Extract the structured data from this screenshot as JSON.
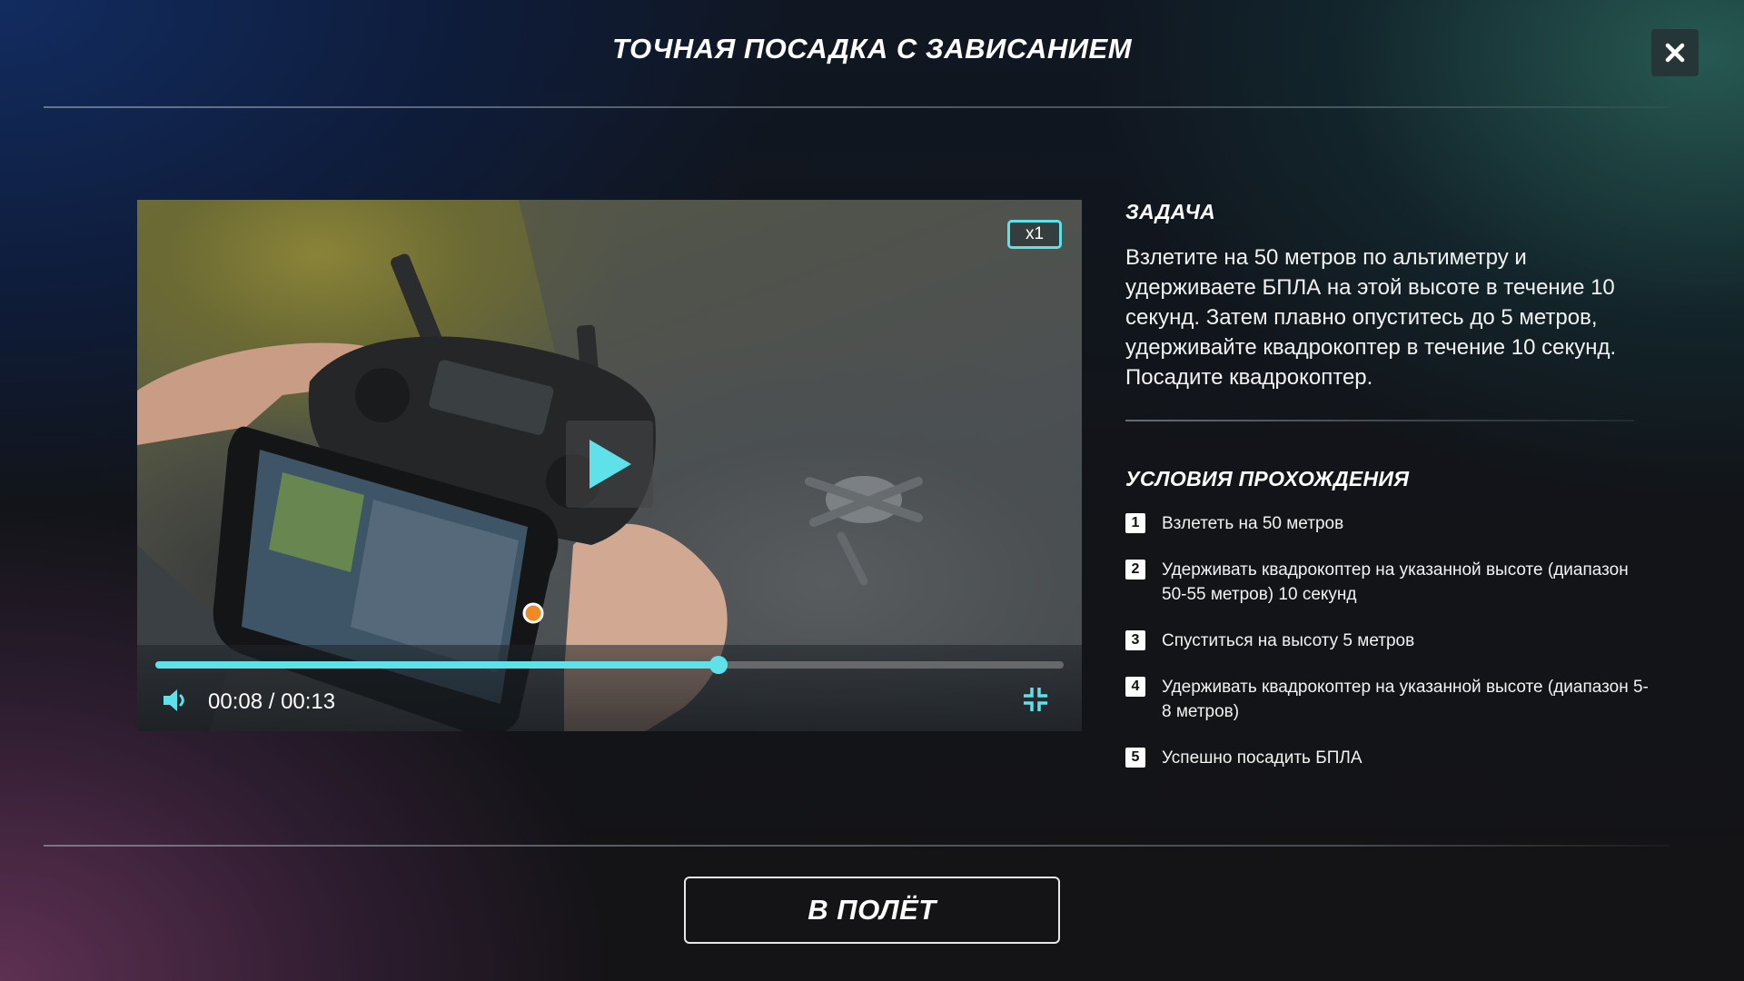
{
  "header": {
    "title": "ТОЧНАЯ ПОСАДКА С ЗАВИСАНИЕМ",
    "close_icon": "close-icon"
  },
  "video": {
    "speed_label": "x1",
    "time_label": "00:08 / 00:13",
    "progress": 0.62,
    "play_icon": "play-icon",
    "volume_icon": "volume-icon",
    "fullscreen_icon": "exit-fullscreen-icon",
    "accent_color": "#5fe1ea"
  },
  "task": {
    "heading": "ЗАДАЧА",
    "text": "Взлетите на 50 метров по альтиметру и удерживаете БПЛА на этой высоте в течение 10 секунд. Затем плавно опуститесь до 5 метров, удерживайте квадрокоптер в течение 10 секунд. Посадите квадрокоптер."
  },
  "conditions": {
    "heading": "УСЛОВИЯ ПРОХОЖДЕНИЯ",
    "items": [
      {
        "num": "1",
        "text": "Взлететь на 50 метров"
      },
      {
        "num": "2",
        "text": "Удерживать квадрокоптер на указанной высоте (диапазон 50-55 метров) 10 секунд"
      },
      {
        "num": "3",
        "text": "Спуститься на высоту 5 метров"
      },
      {
        "num": "4",
        "text": "Удерживать квадрокоптер на указанной высоте (диапазон 5-8 метров)"
      },
      {
        "num": "5",
        "text": "Успешно посадить БПЛА"
      }
    ]
  },
  "footer": {
    "cta_label": "В ПОЛЁТ"
  }
}
